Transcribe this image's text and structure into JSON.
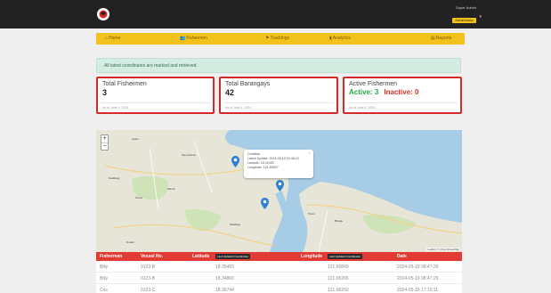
{
  "header": {
    "user_name": "Super Admin",
    "user_role": "Administrator"
  },
  "nav": {
    "items": [
      {
        "label": "Home",
        "icon": "home-icon"
      },
      {
        "label": "Fishermen",
        "icon": "users-icon"
      },
      {
        "label": "Trackings",
        "icon": "location-icon"
      },
      {
        "label": "Analytics",
        "icon": "chart-icon"
      },
      {
        "label": "Reports",
        "icon": "report-icon"
      }
    ]
  },
  "alert": {
    "text": "All latest coordinates are marked and retrieved."
  },
  "cards": {
    "total_fishermen": {
      "title": "Total Fishermen",
      "value": "3",
      "foot": "As of June 4, 2024"
    },
    "total_barangays": {
      "title": "Total Barangays",
      "value": "42",
      "foot": "As of June 4, 2024"
    },
    "active_fishermen": {
      "title": "Active Fishermen",
      "active_label": "Active: 3",
      "inactive_label": "Inactive: 0",
      "foot": "As of June 4, 2024"
    }
  },
  "map": {
    "zoom_in": "+",
    "zoom_out": "−",
    "popup": {
      "name": "Christian",
      "last_update": "Latest Update: 2024-05-19 16:48:23",
      "latitude": "Latitude: 18.32453",
      "longitude": "Longitude: 121.65827",
      "close": "×"
    },
    "attribution": "Leaflet | © OpenStreetMap",
    "places": [
      "Aparri",
      "San Antonio",
      "Gaddang",
      "Maura",
      "Punta",
      "Toran",
      "Bisagu",
      "Paddaya",
      "Dodan"
    ]
  },
  "table": {
    "headers": {
      "fisherman": "Fisherman",
      "vessel": "Vessel No.",
      "latitude": "Latitude",
      "latitude_badge": "Last Updated Coordinates",
      "longitude": "Longitude",
      "longitude_badge": "Last Updated Coordinates",
      "date": "Date"
    },
    "rows": [
      {
        "fisherman": "Billy",
        "vessel": "0123-B",
        "latitude": "18.35483",
        "longitude": "121.65869",
        "date": "2024-05-19 08:47:29"
      },
      {
        "fisherman": "Billy",
        "vessel": "0123-B",
        "latitude": "18.34860",
        "longitude": "121.65265",
        "date": "2024-05-19 08:47:29"
      },
      {
        "fisherman": "Cris",
        "vessel": "0123-C",
        "latitude": "18.36744",
        "longitude": "121.66250",
        "date": "2024-05-19 17:15:11"
      }
    ]
  },
  "colors": {
    "topbar": "#222222",
    "accent_yellow": "#f2c21c",
    "card_border": "#d42a2a",
    "table_header": "#e23b33",
    "active_green": "#22a84a",
    "inactive_red": "#e0302a",
    "map_water": "#a7cde6",
    "map_land": "#e6e5d7"
  }
}
